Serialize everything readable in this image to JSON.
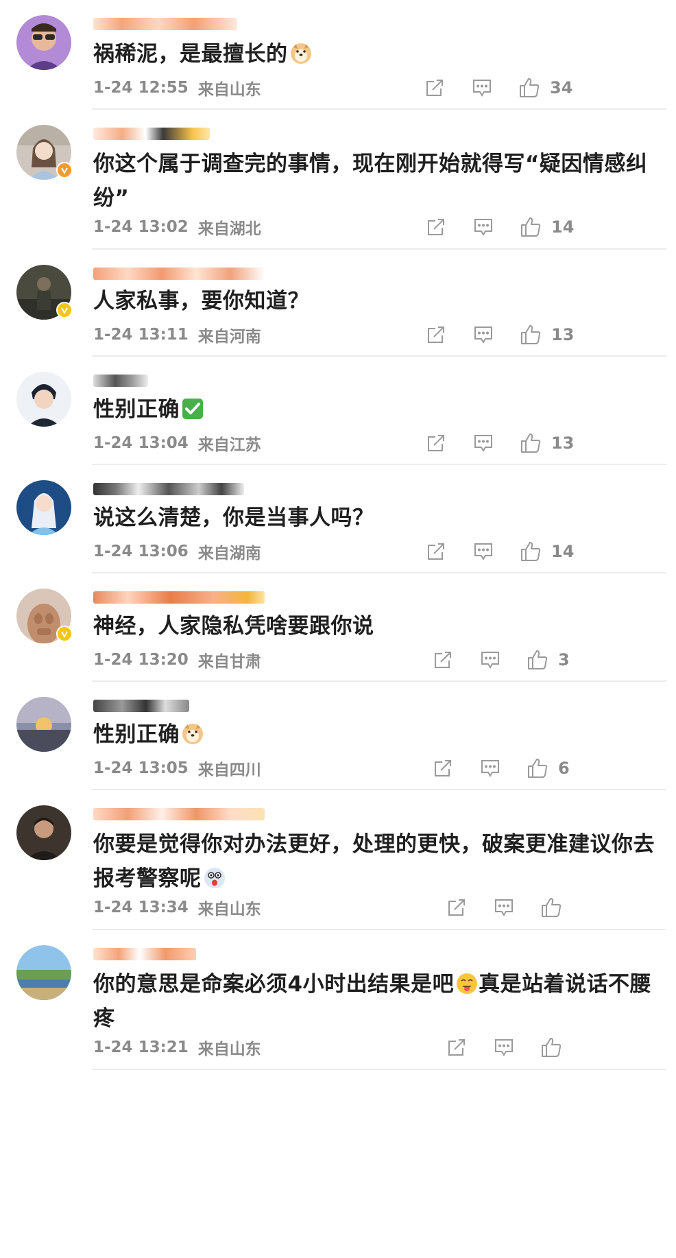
{
  "comments": [
    {
      "text": "祸稀泥，是最擅长的",
      "emoji": "doge-emoji",
      "time": "1-24 12:55",
      "location": "来自山东",
      "likes": "34",
      "verified": false,
      "avatar_colors": [
        "#6b3fa0",
        "#f0c9a8"
      ]
    },
    {
      "text": "你这个属于调查完的事情，现在刚开始就得写“疑因情感纠纷”",
      "emoji": "",
      "time": "1-24 13:02",
      "location": "来自湖北",
      "likes": "14",
      "verified": true,
      "verify_color": "#f29b2f",
      "avatar_colors": [
        "#c9c3bd",
        "#9fb8d6"
      ]
    },
    {
      "text": "人家私事，要你知道？",
      "emoji": "",
      "time": "1-24 13:11",
      "location": "来自河南",
      "likes": "13",
      "verified": true,
      "verify_color": "#f5c518",
      "avatar_colors": [
        "#3f4136",
        "#7a7a62"
      ]
    },
    {
      "text": "性别正确",
      "emoji": "check-mark-emoji",
      "time": "1-24 13:04",
      "location": "来自江苏",
      "likes": "13",
      "verified": false,
      "avatar_colors": [
        "#e8ecf2",
        "#1e2530"
      ]
    },
    {
      "text": "说这么清楚，你是当事人吗？",
      "emoji": "",
      "time": "1-24 13:06",
      "location": "来自湖南",
      "likes": "14",
      "verified": false,
      "avatar_colors": [
        "#2c5f9a",
        "#8cc7ea"
      ]
    },
    {
      "text": "神经，人家隐私凭啥要跟你说",
      "emoji": "",
      "time": "1-24 13:20",
      "location": "来自甘肃",
      "likes": "3",
      "verified": true,
      "verify_color": "#f5c518",
      "avatar_colors": [
        "#c99a7a",
        "#e7c8b2"
      ]
    },
    {
      "text": "性别正确",
      "emoji": "doge-emoji",
      "time": "1-24 13:05",
      "location": "来自四川",
      "likes": "6",
      "verified": false,
      "avatar_colors": [
        "#8b8fa3",
        "#e9a25a"
      ]
    },
    {
      "text": "你要是觉得你对办法更好，处理的更快，破案更准建议你去报考警察呢",
      "emoji": "shocked-face-emoji",
      "time": "1-24 13:34",
      "location": "来自山东",
      "likes": "",
      "verified": false,
      "avatar_colors": [
        "#5a4a3f",
        "#2e2a28"
      ]
    },
    {
      "text": "你的意思是命案必须4小时出结果是吧",
      "text_after": "真是站着说话不腰疼",
      "emoji": "tongue-face-emoji",
      "time": "1-24 13:21",
      "location": "来自山东",
      "likes": "",
      "verified": false,
      "avatar_colors": [
        "#7fb6e0",
        "#6b8f55"
      ]
    }
  ],
  "colors": {
    "text": "#1f1f1f",
    "meta": "#8a8a8a",
    "divider": "#ececec",
    "username_blur": "#f2a77a"
  }
}
